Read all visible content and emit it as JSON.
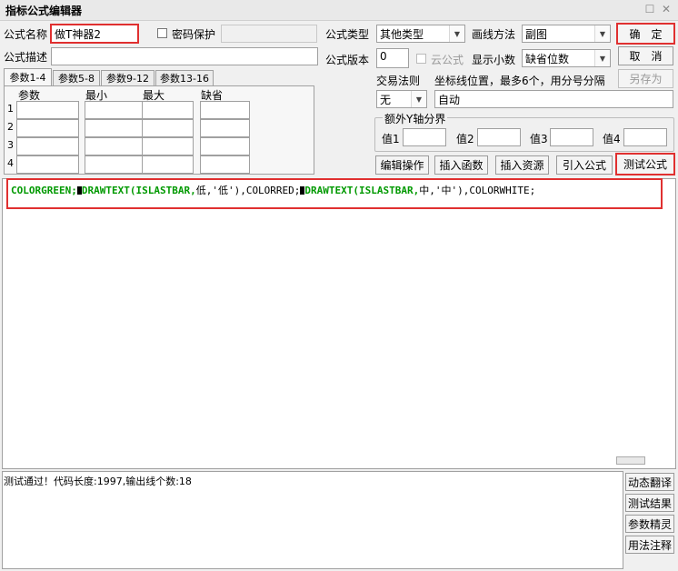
{
  "window": {
    "title": "指标公式编辑器"
  },
  "top": {
    "formula_name_label": "公式名称",
    "formula_name_value": "做T神器2",
    "password_label": "密码保护",
    "formula_type_label": "公式类型",
    "formula_type_value": "其他类型",
    "draw_method_label": "画线方法",
    "draw_method_value": "副图",
    "confirm_label": "确　定",
    "desc_label": "公式描述",
    "desc_value": "",
    "version_label": "公式版本",
    "version_value": "0",
    "cloud_label": "云公式",
    "decimal_label": "显示小数",
    "decimal_value": "缺省位数",
    "cancel_label": "取　消",
    "saveas_label": "另存为"
  },
  "tabs": [
    "参数1-4",
    "参数5-8",
    "参数9-12",
    "参数13-16"
  ],
  "params": {
    "headers": [
      "参数",
      "最小",
      "最大",
      "缺省"
    ],
    "rows": [
      "1",
      "2",
      "3",
      "4"
    ]
  },
  "right_panel": {
    "trade_rule_label": "交易法则",
    "trade_rule_value": "无",
    "coord_label": "坐标线位置，最多6个，用分号分隔",
    "coord_value": "自动",
    "y_axis_group_label": "额外Y轴分界",
    "value_labels": [
      "值1",
      "值2",
      "值3",
      "值4"
    ]
  },
  "buttons": {
    "edit_ops": "编辑操作",
    "insert_func": "插入函数",
    "insert_res": "插入资源",
    "import_formula": "引入公式",
    "test_formula": "测试公式"
  },
  "code": {
    "t1": "COLORGREEN;",
    "t2": "DRAWTEXT(ISLASTBAR,",
    "t3": "低,'低'),COLORRED;",
    "t4": "DRAWTEXT(ISLASTBAR,",
    "t5": "中,'中'),COLORWHITE;"
  },
  "output": {
    "text": "测试通过！代码长度:1997,输出线个数:18"
  },
  "side_buttons": [
    "动态翻译",
    "测试结果",
    "参数精灵",
    "用法注释"
  ]
}
